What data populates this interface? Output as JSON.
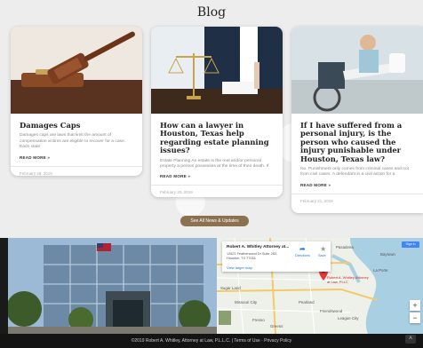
{
  "blog": {
    "title": "Blog"
  },
  "posts": [
    {
      "title": "Damages Caps",
      "excerpt": "Damages caps are laws that limit the amount of compensation victims are eligible to recover for a case. Each state",
      "more": "READ MORE »",
      "date": "February 28, 2019",
      "image_icon": "gavel-icon"
    },
    {
      "title": "How can a lawyer in Houston, Texas help regarding estate planning issues?",
      "excerpt": "Estate Planning An estate is the real and/or personal property a person possesses at the time of their death. If",
      "more": "READ MORE »",
      "date": "February 20, 2019",
      "image_icon": "scales-of-justice-icon"
    },
    {
      "title": "If I have suffered from a personal injury, is the person who caused the injury punishable under Houston, Texas law?",
      "excerpt": "No. Punishment only comes from criminal cases and not from civil cases. A defendant in a civil action for a",
      "more": "READ MORE »",
      "date": "February 21, 2019",
      "image_icon": "injured-patient-icon"
    }
  ],
  "see_all": "See All News & Updates",
  "map": {
    "card_title": "Robert A. Whitley Attorney at...",
    "address_line1": "12621 Featherwood Dr Suite 282,",
    "address_line2": "Houston, TX 77034",
    "directions": "Directions",
    "save": "Save",
    "larger_map": "View larger map",
    "marker_label": "Robert A. Whitley Attorney at Law, PLLC",
    "signin": "Sign in",
    "labels": {
      "baytown": "Baytown",
      "pearland": "Pearland",
      "friendswood": "Friendswood",
      "league_city": "League City",
      "pasadena": "Pasadena",
      "sugar_land": "Sugar Land",
      "missouri_city": "Missouri City",
      "fresno": "Fresno",
      "greens": "Greens",
      "pearland_south": "Pearland",
      "la_porte": "La Porte"
    },
    "zoom_in": "+",
    "zoom_out": "−"
  },
  "footer": {
    "text": "©2019 Robert A. Whitley, Attorney at Law, P.L.L.C. | Terms of Use · Privacy Policy"
  },
  "scroll_top": "˄",
  "colors": {
    "accent": "#8a7150",
    "footer_bg": "#141414",
    "marker": "#e53935"
  }
}
